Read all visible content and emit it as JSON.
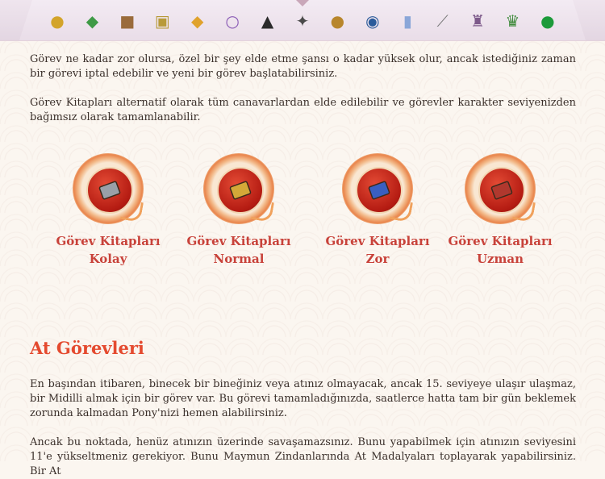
{
  "toolbar": {
    "icons": [
      {
        "name": "gold-pile-icon",
        "glyph": "●",
        "color": "#d3a42a"
      },
      {
        "name": "green-scroll-icon",
        "glyph": "◆",
        "color": "#3e9a46"
      },
      {
        "name": "wooden-chest-icon",
        "glyph": "■",
        "color": "#9a6b3b"
      },
      {
        "name": "golden-chest-icon",
        "glyph": "▣",
        "color": "#b89a3a"
      },
      {
        "name": "topaz-gem-icon",
        "glyph": "◆",
        "color": "#e0a22c"
      },
      {
        "name": "purple-ring-icon",
        "glyph": "○",
        "color": "#8a5bb5"
      },
      {
        "name": "dark-cape-icon",
        "glyph": "▲",
        "color": "#2b2b2b"
      },
      {
        "name": "gauntlet-icon",
        "glyph": "✦",
        "color": "#4a4a4a"
      },
      {
        "name": "gold-coin-icon",
        "glyph": "●",
        "color": "#b8862c"
      },
      {
        "name": "blue-orb-icon",
        "glyph": "◉",
        "color": "#2a5a9a"
      },
      {
        "name": "potion-vial-icon",
        "glyph": "▮",
        "color": "#8aa6d8"
      },
      {
        "name": "fishing-rod-icon",
        "glyph": "⟋",
        "color": "#7a7a7a"
      },
      {
        "name": "crystal-shrine-icon",
        "glyph": "♜",
        "color": "#7d5a8a"
      },
      {
        "name": "green-lamp-icon",
        "glyph": "♛",
        "color": "#3e8a3a"
      },
      {
        "name": "green-pearl-icon",
        "glyph": "●",
        "color": "#1c9a3a"
      }
    ]
  },
  "intro": {
    "para1": "Görev ne kadar zor olursa, özel bir şey elde etme şansı o kadar yüksek olur, ancak istediğiniz zaman bir görevi iptal edebilir ve yeni bir görev başlatabilirsiniz.",
    "para2": "Görev Kitapları alternatif olarak tüm canavarlardan elde edilebilir ve görevler karakter seviyenizden bağımsız olarak tamamlanabilir."
  },
  "books": [
    {
      "line1": "Görev Kitapları",
      "line2": "Kolay",
      "color": "#9aa0a8"
    },
    {
      "line1": "Görev Kitapları",
      "line2": "Normal",
      "color": "#d4a838"
    },
    {
      "line1": "Görev Kitapları",
      "line2": "Zor",
      "color": "#3a5fc0"
    },
    {
      "line1": "Görev Kitapları",
      "line2": "Uzman",
      "color": "#b0382e"
    }
  ],
  "horse_section": {
    "title": "At Görevleri",
    "para1": "En başından itibaren, binecek bir bineğiniz veya atınız olmayacak, ancak 15. seviyeye ulaşır ulaşmaz, bir Midilli almak için bir görev var. Bu görevi tamamladığınızda, saatlerce hatta tam bir gün beklemek zorunda kalmadan Pony'nizi hemen alabilirsiniz.",
    "para2": "Ancak bu noktada, henüz atınızın üzerinde savaşamazsınız. Bunu yapabilmek için atınızın seviyesini 11'e yükseltmeniz gerekiyor. Bunu Maymun Zindanlarında At Madalyaları toplayarak yapabilirsiniz. Bir At"
  }
}
